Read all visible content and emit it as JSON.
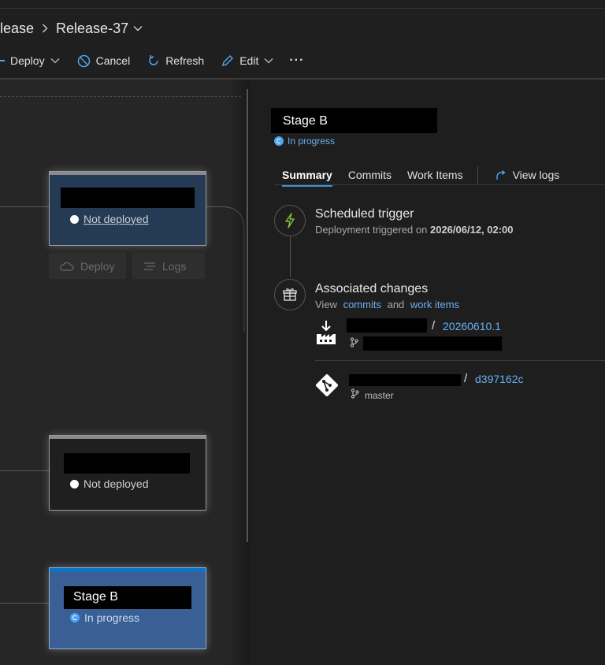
{
  "breadcrumb": {
    "parent": "lease",
    "release": "Release-37"
  },
  "toolbar": {
    "deploy": "Deploy",
    "cancel": "Cancel",
    "refresh": "Refresh",
    "edit": "Edit",
    "more": "···"
  },
  "pipeline": {
    "stages": [
      {
        "status": "Not deployed"
      },
      {
        "status": "Not deployed"
      },
      {
        "name": "Stage B",
        "status": "In progress"
      }
    ],
    "actions": {
      "deploy": "Deploy",
      "logs": "Logs"
    }
  },
  "panel": {
    "title": "Stage B",
    "status": "In progress",
    "tabs": [
      "Summary",
      "Commits",
      "Work Items"
    ],
    "view_logs": "View logs",
    "trigger": {
      "title": "Scheduled trigger",
      "prefix": "Deployment triggered on ",
      "datetime": "2026/06/12, 02:00"
    },
    "changes": {
      "title": "Associated changes",
      "view": "View",
      "commits_link": "commits",
      "and": "and",
      "work_items_link": "work items"
    },
    "artifacts": [
      {
        "version": "20260610.1"
      },
      {
        "version": "d397162c",
        "branch": "master"
      }
    ],
    "slash": "/"
  },
  "colors": {
    "accent": "#0078d4",
    "link": "#6ab0f5",
    "selected_stage": "#3a5f94"
  }
}
